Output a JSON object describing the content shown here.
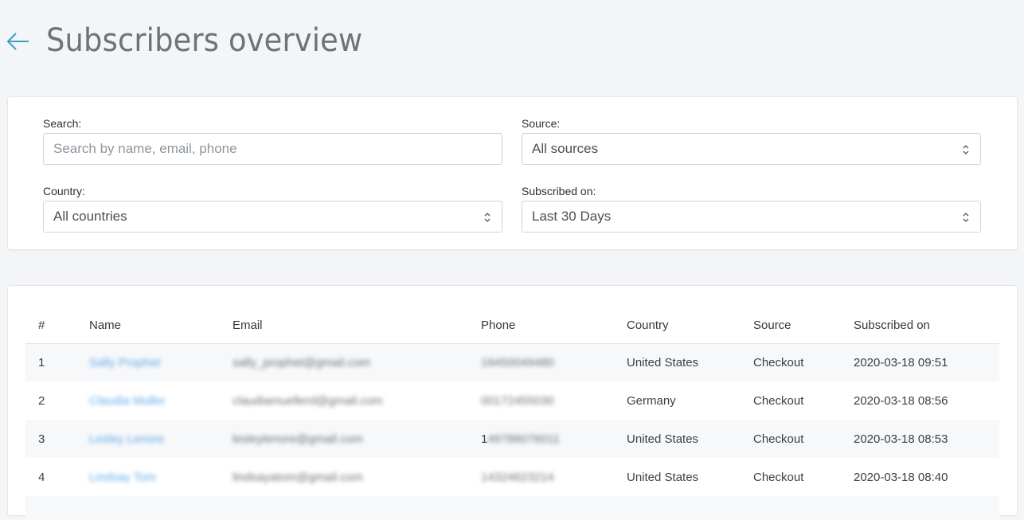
{
  "header": {
    "title": "Subscribers overview"
  },
  "filters": {
    "search": {
      "label": "Search:",
      "placeholder": "Search by name, email, phone",
      "value": ""
    },
    "source": {
      "label": "Source:",
      "value": "All sources"
    },
    "country": {
      "label": "Country:",
      "value": "All countries"
    },
    "subscribed_on": {
      "label": "Subscribed on:",
      "value": "Last 30 Days"
    }
  },
  "table": {
    "columns": [
      "#",
      "Name",
      "Email",
      "Phone",
      "Country",
      "Source",
      "Subscribed on"
    ],
    "rows": [
      {
        "num": "1",
        "name": "Sally Prophet",
        "email": "sally_prophet@gmail.com",
        "phone": "16450049480",
        "country": "United States",
        "source": "Checkout",
        "subscribed_on": "2020-03-18 09:51"
      },
      {
        "num": "2",
        "name": "Claudia Muller",
        "email": "claudiamuellerd@gmail.com",
        "phone": "00172455030",
        "country": "Germany",
        "source": "Checkout",
        "subscribed_on": "2020-03-18 08:56"
      },
      {
        "num": "3",
        "name": "Lesley Lenore",
        "email": "lesleylenore@gmail.com",
        "phone_first": "1",
        "phone": "49786076011",
        "country": "United States",
        "source": "Checkout",
        "subscribed_on": "2020-03-18 08:53"
      },
      {
        "num": "4",
        "name": "Lindsay Tom",
        "email": "lindsayatom@gmail.com",
        "phone": "14324623214",
        "country": "United States",
        "source": "Checkout",
        "subscribed_on": "2020-03-18 08:40"
      }
    ]
  },
  "colors": {
    "accent": "#3aa0c8",
    "link": "#5fa8e8",
    "background": "#f4f5f7"
  },
  "icons": {
    "back": "arrow-left-icon",
    "select": "select-arrows-icon"
  }
}
